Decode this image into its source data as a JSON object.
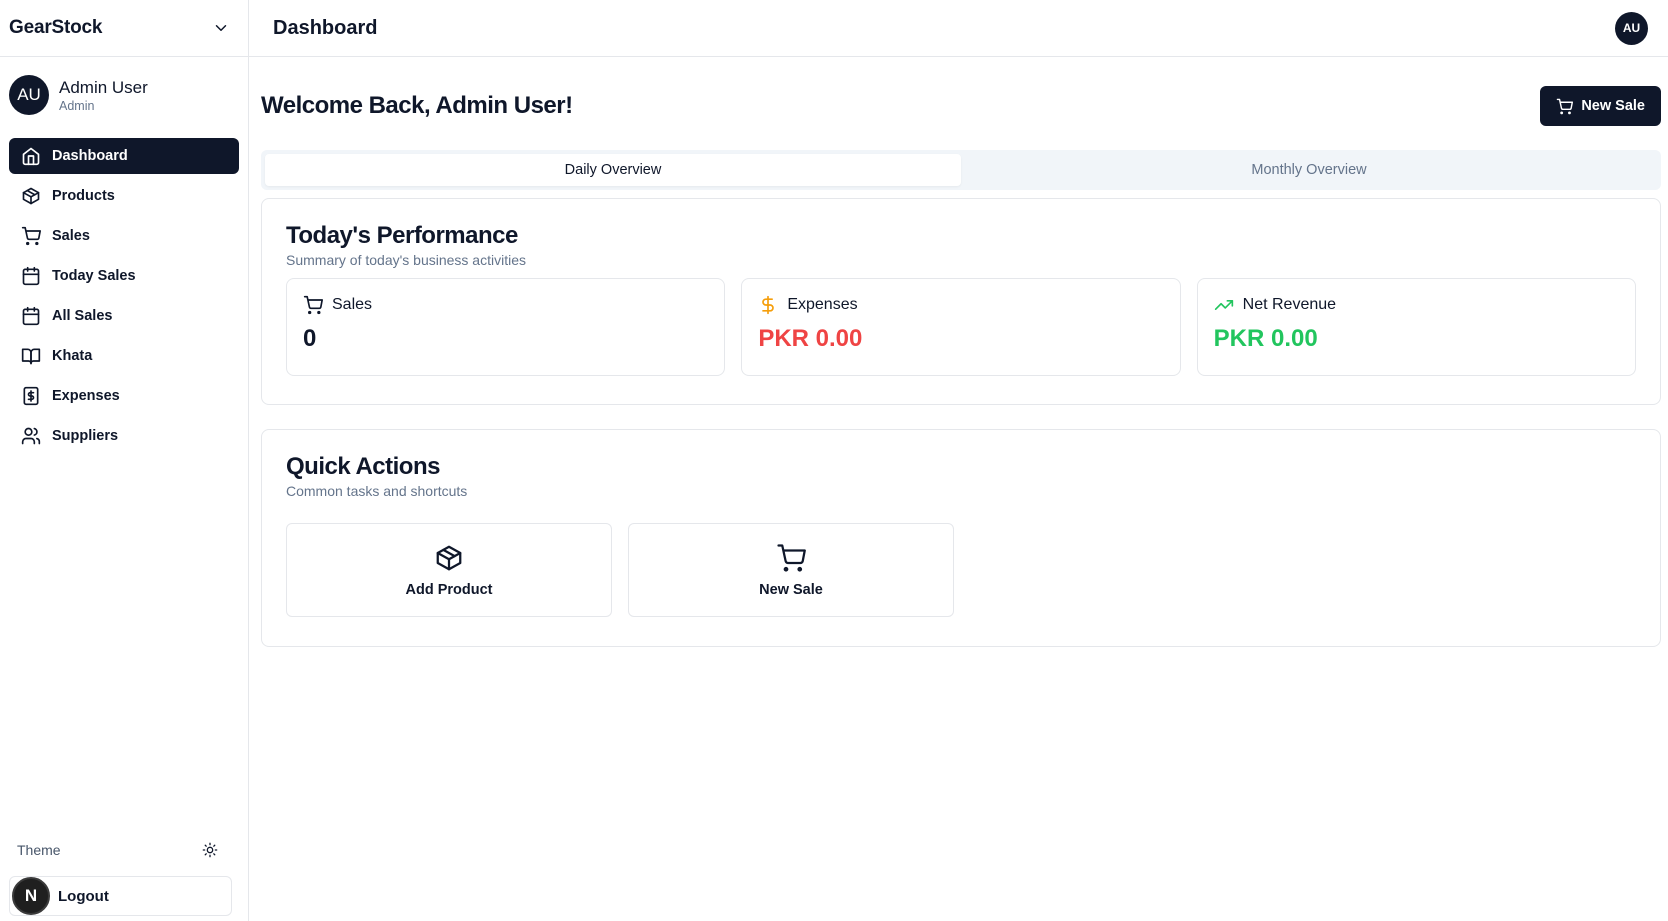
{
  "app": {
    "brand": "GearStock"
  },
  "user": {
    "initials": "AU",
    "name": "Admin User",
    "role": "Admin"
  },
  "sidebar": {
    "items": [
      {
        "label": "Dashboard",
        "icon": "home-icon",
        "active": true
      },
      {
        "label": "Products",
        "icon": "package-icon"
      },
      {
        "label": "Sales",
        "icon": "cart-icon"
      },
      {
        "label": "Today Sales",
        "icon": "calendar-icon"
      },
      {
        "label": "All Sales",
        "icon": "calendar-icon"
      },
      {
        "label": "Khata",
        "icon": "book-icon"
      },
      {
        "label": "Expenses",
        "icon": "receipt-dollar-icon"
      },
      {
        "label": "Suppliers",
        "icon": "users-icon"
      }
    ],
    "theme_label": "Theme",
    "logout_label": "Logout",
    "logout_badge": "N"
  },
  "header": {
    "title": "Dashboard",
    "avatar": "AU"
  },
  "main": {
    "welcome": "Welcome Back, Admin User!",
    "new_sale_label": "New Sale",
    "tabs": [
      {
        "label": "Daily Overview",
        "active": true
      },
      {
        "label": "Monthly Overview"
      }
    ],
    "performance": {
      "title": "Today's Performance",
      "subtitle": "Summary of today's business activities",
      "stats": [
        {
          "label": "Sales",
          "value": "0",
          "icon": "cart-icon",
          "color": "#0f172a"
        },
        {
          "label": "Expenses",
          "value": "PKR 0.00",
          "icon": "dollar-icon",
          "color": "#ef4444",
          "icon_color": "#f59e0b"
        },
        {
          "label": "Net Revenue",
          "value": "PKR 0.00",
          "icon": "trending-up-icon",
          "color": "#22c55e",
          "icon_color": "#22c55e"
        }
      ]
    },
    "quick_actions": {
      "title": "Quick Actions",
      "subtitle": "Common tasks and shortcuts",
      "items": [
        {
          "label": "Add Product",
          "icon": "package-icon"
        },
        {
          "label": "New Sale",
          "icon": "cart-icon"
        }
      ]
    }
  },
  "colors": {
    "primary": "#0f172a",
    "muted": "#64748b",
    "border": "#e5e7eb",
    "danger": "#ef4444",
    "success": "#22c55e",
    "warning": "#f59e0b"
  }
}
